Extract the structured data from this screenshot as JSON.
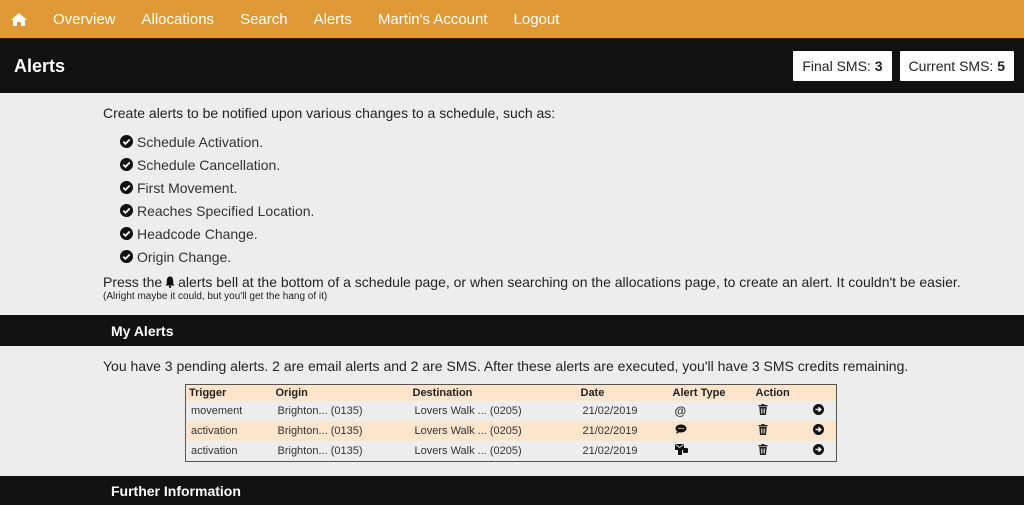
{
  "nav": {
    "home_icon": "home-icon",
    "items": [
      "Overview",
      "Allocations",
      "Search",
      "Alerts",
      "Martin's Account",
      "Logout"
    ]
  },
  "header": {
    "title": "Alerts",
    "final_sms_label": "Final SMS:",
    "final_sms_value": "3",
    "current_sms_label": "Current SMS:",
    "current_sms_value": "5"
  },
  "intro": {
    "lead": "Create alerts to be notified upon various changes to a schedule, such as:",
    "items": [
      "Schedule Activation.",
      "Schedule Cancellation.",
      "First Movement.",
      "Reaches Specified Location.",
      "Headcode Change.",
      "Origin Change."
    ],
    "press_before": "Press the",
    "press_after": "alerts bell at the bottom of a schedule page, or when searching on the allocations page, to create an alert. It couldn't be easier.",
    "small_note": "(Alright maybe it could, but you'll get the hang of it)"
  },
  "my_alerts": {
    "heading": "My Alerts",
    "summary": "You have 3 pending alerts. 2 are email alerts and 2 are SMS. After these alerts are executed, you'll have 3 SMS credits remaining.",
    "columns": [
      "Trigger",
      "Origin",
      "Destination",
      "Date",
      "Alert Type",
      "Action",
      ""
    ],
    "rows": [
      {
        "trigger": "movement",
        "origin": "Brighton... (0135)",
        "destination": "Lovers Walk ... (0205)",
        "date": "21/02/2019",
        "alert_type": "email-icon"
      },
      {
        "trigger": "activation",
        "origin": "Brighton... (0135)",
        "destination": "Lovers Walk ... (0205)",
        "date": "21/02/2019",
        "alert_type": "sms-icon"
      },
      {
        "trigger": "activation",
        "origin": "Brighton... (0135)",
        "destination": "Lovers Walk ... (0205)",
        "date": "21/02/2019",
        "alert_type": "email-and-sms-icon"
      }
    ]
  },
  "further": {
    "heading": "Further Information"
  },
  "colors": {
    "nav_bg": "#e09a35",
    "header_bg": "#111111",
    "row_alt": "#fde5cc",
    "page_bg": "#ededed"
  }
}
